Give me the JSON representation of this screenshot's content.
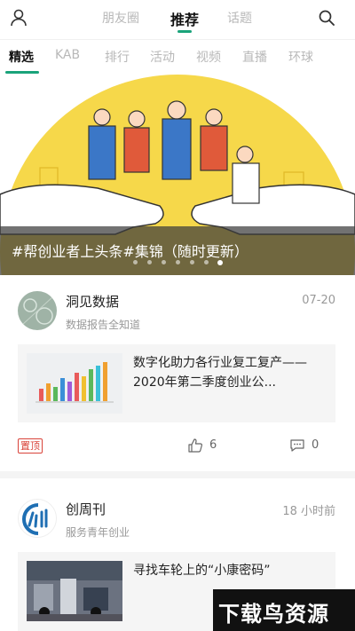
{
  "top_tabs": {
    "left": "朋友圈",
    "center": "推荐",
    "right": "话题"
  },
  "sub_nav": [
    "精选",
    "KAB",
    "排行",
    "活动",
    "视频",
    "直播",
    "环球"
  ],
  "banner": {
    "caption": "#帮创业者上头条#集锦（随时更新）",
    "dots": 7,
    "active_dot": 6,
    "bg_color": "#f6d84a"
  },
  "feed": [
    {
      "author": "洞见数据",
      "subtitle": "数据报告全知道",
      "time": "07-20",
      "article_title": "数字化助力各行业复工复产——2020年第二季度创业公...",
      "pin_label": "置顶",
      "likes": "6",
      "comments": "0"
    },
    {
      "author": "创周刊",
      "subtitle": "服务青年创业",
      "time": "18 小时前",
      "article_title": "寻找车轮上的“小康密码”"
    }
  ],
  "watermark": "下载鸟资源",
  "colors": {
    "accent": "#1aa37a",
    "pin": "#d9433a"
  },
  "icons": [
    "user-icon",
    "search-icon",
    "thumbs-up-icon",
    "comment-icon"
  ]
}
